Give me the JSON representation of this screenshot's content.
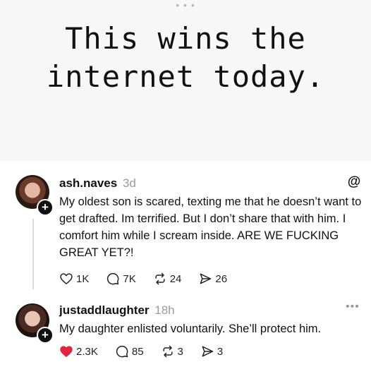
{
  "caption": {
    "line1": "This wins the",
    "line2": "internet today."
  },
  "posts": [
    {
      "username": "ash.naves",
      "time": "3d",
      "text": "My oldest son is scared, texting me that he doesn’t want to get drafted. Im terrified. But I don’t share that with him. I comfort him while I scream inside. ARE WE FUCKING GREAT YET?!",
      "likes": "1K",
      "comments": "7K",
      "reposts": "24",
      "shares": "26",
      "liked": false
    },
    {
      "username": "justaddlaughter",
      "time": "18h",
      "text": "My daughter enlisted voluntarily. She’ll protect him.",
      "likes": "2.3K",
      "comments": "85",
      "reposts": "3",
      "shares": "3",
      "liked": true
    }
  ],
  "colors": {
    "like_active": "#e0243a",
    "muted": "#9a9a9a"
  },
  "icons": [
    "threads-logo-icon",
    "heart-icon",
    "comment-icon",
    "repost-icon",
    "share-icon",
    "more-icon",
    "follow-plus-icon"
  ]
}
